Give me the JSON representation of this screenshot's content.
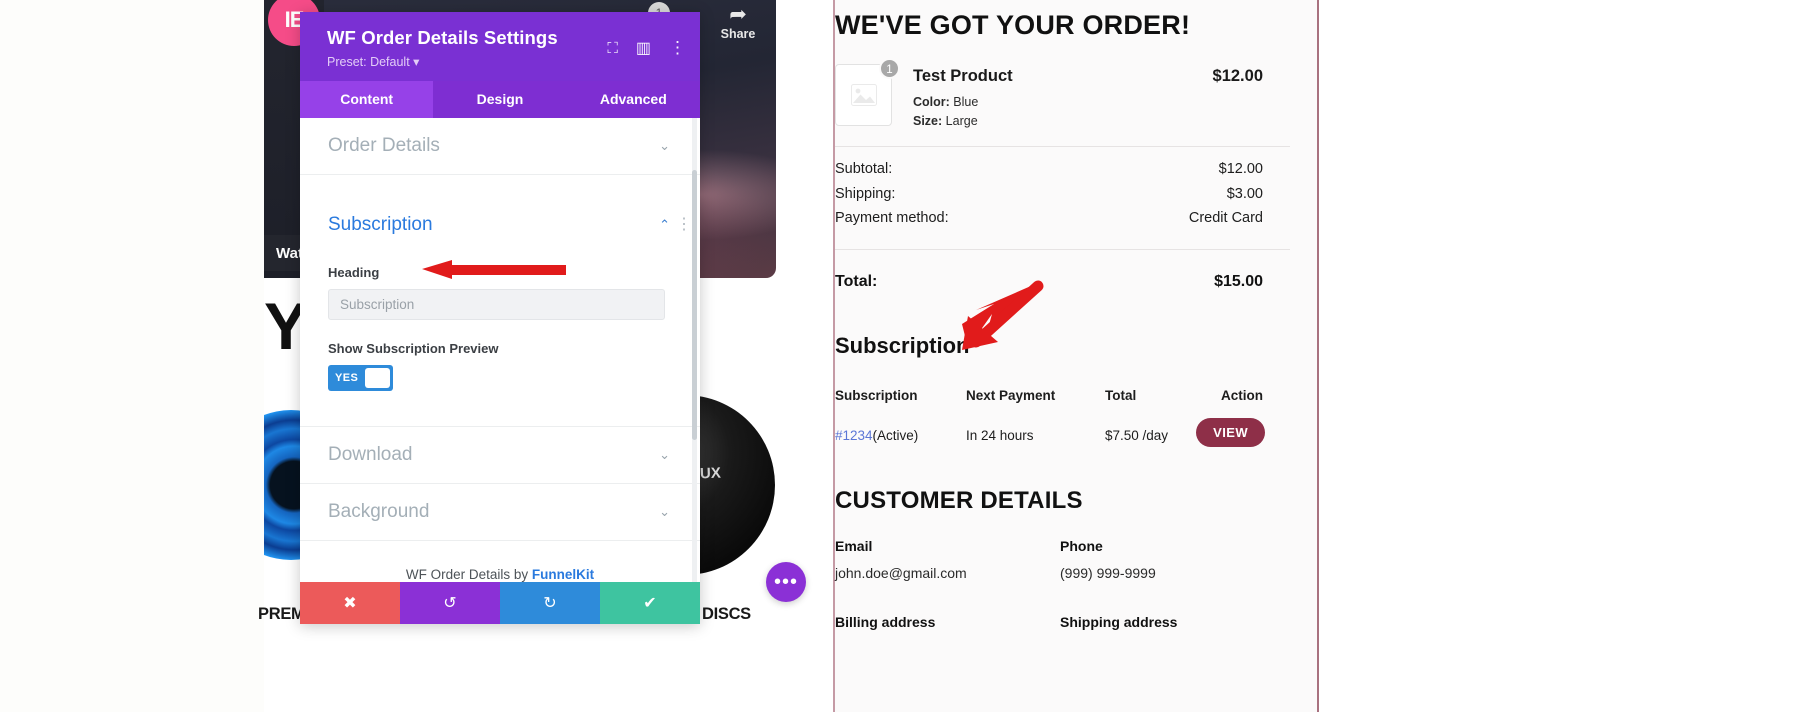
{
  "editor_panel": {
    "title": "WF Order Details Settings",
    "preset": "Preset: Default",
    "preset_caret": "▾",
    "header_icons": [
      {
        "name": "responsive-preview-icon",
        "glyph": "⛶"
      },
      {
        "name": "panel-layout-icon",
        "glyph": "▥"
      },
      {
        "name": "kebab-menu-icon",
        "glyph": "⋮"
      }
    ],
    "tabs": [
      {
        "label": "Content",
        "active": true
      },
      {
        "label": "Design",
        "active": false
      },
      {
        "label": "Advanced",
        "active": false
      }
    ],
    "sections": [
      {
        "label": "Order Details",
        "open": false
      },
      {
        "label": "Subscription",
        "open": true
      },
      {
        "label": "Download",
        "open": false
      },
      {
        "label": "Background",
        "open": false
      }
    ],
    "controls": {
      "heading_label": "Heading",
      "heading_placeholder": "Subscription",
      "heading_value": "",
      "toggle_label": "Show Subscription Preview",
      "toggle_state": "YES"
    },
    "credit_text": "WF Order Details by ",
    "credit_link": "FunnelKit",
    "footer_buttons": [
      {
        "name": "discard-button",
        "glyph": "✖"
      },
      {
        "name": "undo-button",
        "glyph": "↺"
      },
      {
        "name": "redo-button",
        "glyph": "↻"
      },
      {
        "name": "publish-button",
        "glyph": "✔"
      }
    ]
  },
  "canvas": {
    "avatar_glyph": "IE",
    "share_label": "Share",
    "share_glyph": "➦",
    "badge_count": "1",
    "watch_label": "Wat",
    "big_text": "YO",
    "disc_label": "UX",
    "product_title_left": "PREMIUM NON-SLIP EXERCISE",
    "product_title_right": "DUAL-SIDED GLIDING DISCS",
    "fab_glyph": "•••"
  },
  "order": {
    "heading": "WE'VE GOT YOUR ORDER!",
    "item": {
      "name": "Test Product",
      "qty_badge": "1",
      "price": "$12.00",
      "attributes": [
        {
          "label": "Color:",
          "value": "Blue"
        },
        {
          "label": "Size:",
          "value": "Large"
        }
      ]
    },
    "totals": [
      {
        "label": "Subtotal:",
        "value": "$12.00"
      },
      {
        "label": "Shipping:",
        "value": "$3.00"
      },
      {
        "label": "Payment method:",
        "value": "Credit Card"
      }
    ],
    "total": {
      "label": "Total:",
      "value": "$15.00"
    },
    "subscription": {
      "heading": "Subscription",
      "columns": [
        "Subscription",
        "Next Payment",
        "Total",
        "Action"
      ],
      "rows": [
        {
          "id": "#1234",
          "status": "(Active)",
          "next_payment": "In 24 hours",
          "total": "$7.50 /day",
          "action": "VIEW"
        }
      ]
    },
    "customer": {
      "heading": "CUSTOMER DETAILS",
      "email_label": "Email",
      "email_value": "john.doe@gmail.com",
      "phone_label": "Phone",
      "phone_value": "(999) 999-9999",
      "billing_label": "Billing address",
      "shipping_label": "Shipping address"
    }
  },
  "colors": {
    "editor_purple": "#7a30d3",
    "tab_active": "#9641e8",
    "toggle_blue": "#2e8bda",
    "view_button": "#8e2f48",
    "link_blue": "#2a7ade",
    "annotation_red": "#e11b1b"
  }
}
